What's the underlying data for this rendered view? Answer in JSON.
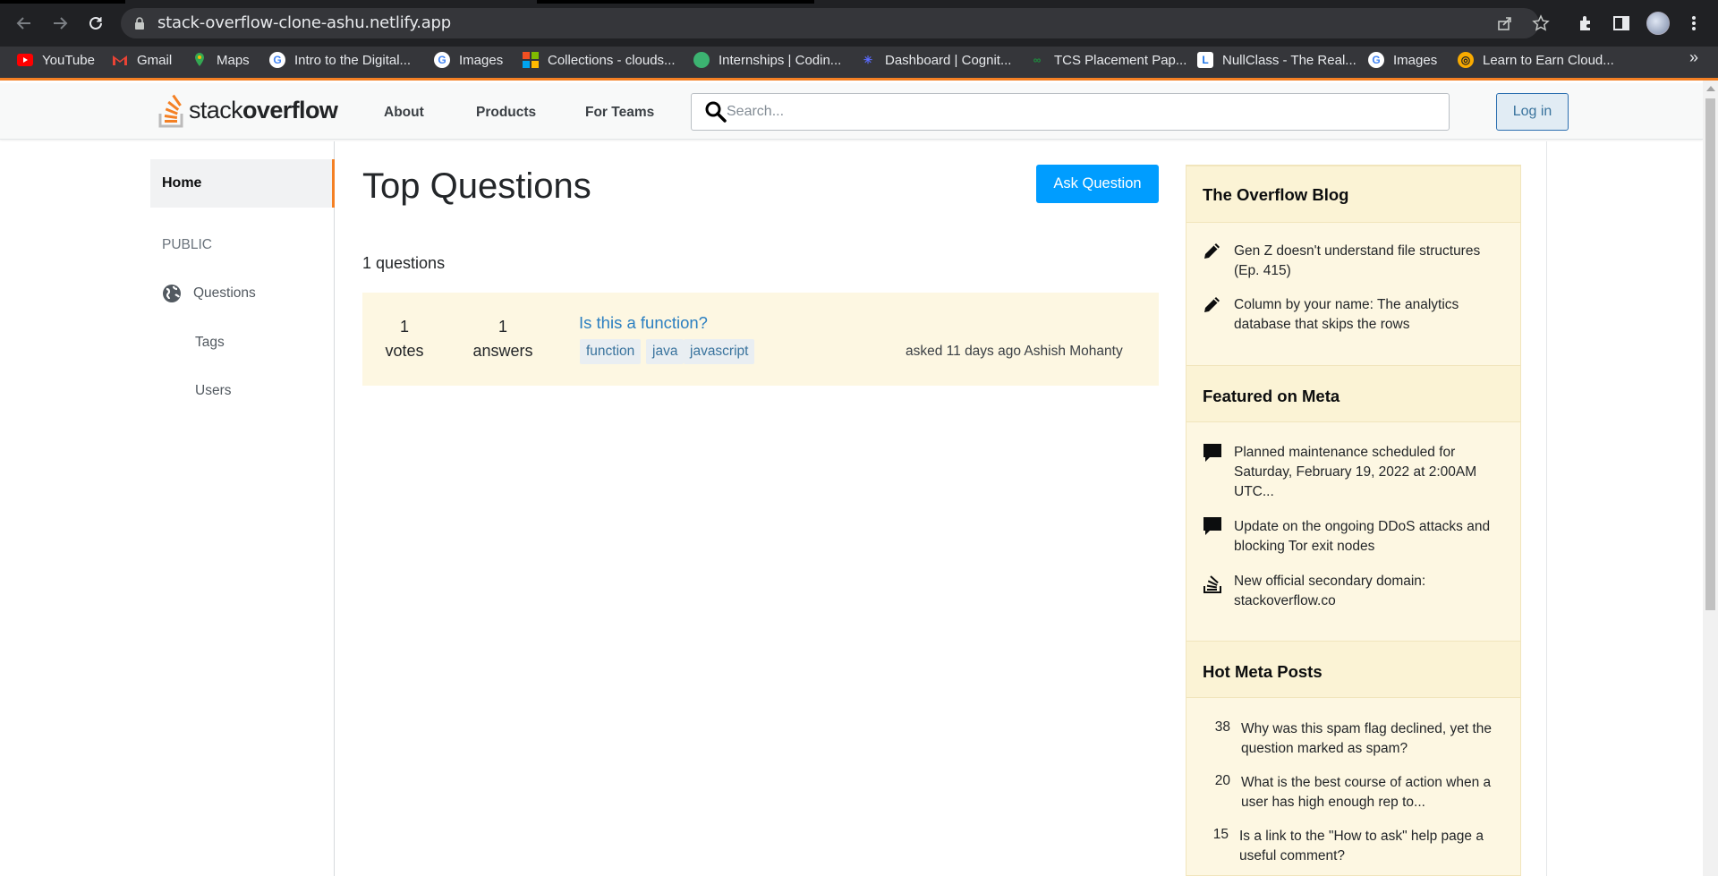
{
  "browser": {
    "url": "stack-overflow-clone-ashu.netlify.app",
    "bookmarks": [
      {
        "label": "YouTube",
        "color": "#ff0000"
      },
      {
        "label": "Gmail",
        "color": "#ea4335"
      },
      {
        "label": "Maps",
        "color": "#34a853"
      },
      {
        "label": "Intro to the Digital...",
        "color": "#4285f4"
      },
      {
        "label": "Images",
        "color": "#4285f4"
      },
      {
        "label": "Collections - clouds...",
        "color": "#f25022"
      },
      {
        "label": "Internships | Codin...",
        "color": "#3cb371"
      },
      {
        "label": "Dashboard | Cognit...",
        "color": "#5b6bff"
      },
      {
        "label": "TCS Placement Pap...",
        "color": "#1e8e3e"
      },
      {
        "label": "NullClass - The Real...",
        "color": "#1a73e8"
      },
      {
        "label": "Images",
        "color": "#4285f4"
      },
      {
        "label": "Learn to Earn Cloud...",
        "color": "#f9ab00"
      }
    ],
    "more": "»"
  },
  "header": {
    "logo_plain": "stack",
    "logo_bold": "overflow",
    "nav": [
      "About",
      "Products",
      "For Teams"
    ],
    "search_placeholder": "Search...",
    "login_label": "Log in",
    "accent": "#f48024"
  },
  "sidebar": {
    "home": "Home",
    "section": "PUBLIC",
    "questions": "Questions",
    "tags": "Tags",
    "users": "Users"
  },
  "main": {
    "title": "Top Questions",
    "ask_label": "Ask Question",
    "count_text": "1 questions",
    "questions": [
      {
        "votes": "1",
        "votes_label": "votes",
        "answers": "1",
        "answers_label": "answers",
        "title": "Is this a function?",
        "tags": [
          "function",
          "java",
          "javascript"
        ],
        "meta": "asked 11 days ago Ashish Mohanty"
      }
    ]
  },
  "right": {
    "blog_title": "The Overflow Blog",
    "blog_items": [
      "Gen Z doesn't understand file structures (Ep. 415)",
      "Column by your name: The analytics database that skips the rows"
    ],
    "meta_title": "Featured on Meta",
    "meta_items": [
      "Planned maintenance scheduled for Saturday, February 19, 2022 at 2:00AM UTC...",
      "Update on the ongoing DDoS attacks and blocking Tor exit nodes",
      "New official secondary domain: stackoverflow.co"
    ],
    "hot_title": "Hot Meta Posts",
    "hot_items": [
      {
        "count": "38",
        "text": "Why was this spam flag declined, yet the question marked as spam?"
      },
      {
        "count": "20",
        "text": "What is the best course of action when a user has high enough rep to..."
      },
      {
        "count": "15",
        "text": "Is a link to the \"How to ask\" help page a useful comment?"
      }
    ]
  }
}
